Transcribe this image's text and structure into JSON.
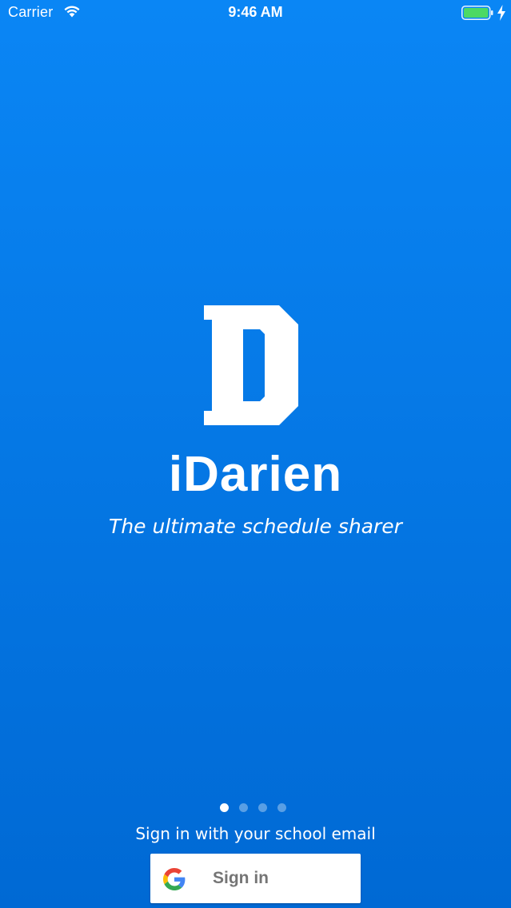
{
  "status_bar": {
    "carrier": "Carrier",
    "time": "9:46 AM",
    "wifi_icon": "wifi-icon",
    "battery_icon": "battery-full-icon",
    "charging_icon": "charging-bolt-icon",
    "battery_color": "#4cd964"
  },
  "branding": {
    "logo_icon": "letter-d-logo",
    "app_name": "iDarien",
    "tagline": "The ultimate schedule sharer"
  },
  "pager": {
    "count": 4,
    "active_index": 0
  },
  "sign_in": {
    "hint": "Sign in with your school email",
    "button_label": "Sign in",
    "button_icon": "google-g-icon"
  },
  "colors": {
    "background_top": "#0a86f5",
    "background_bottom": "#0069d4",
    "text": "#ffffff",
    "button_text": "#757575"
  }
}
